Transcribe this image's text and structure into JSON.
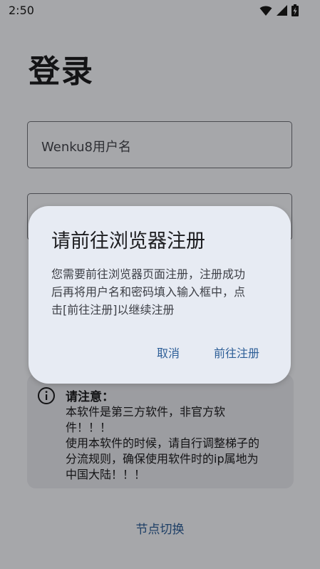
{
  "status_bar": {
    "time": "2:50",
    "icons": [
      "wifi-icon",
      "signal-icon",
      "battery-charging-icon"
    ]
  },
  "page": {
    "title": "登录",
    "username_placeholder": "Wenku8用户名",
    "password_placeholder": ""
  },
  "notice": {
    "icon": "info-icon",
    "title": "请注意：",
    "lines": [
      "本软件是第三方软件，非官方软",
      "件！！！",
      "使用本软件的时候，请自行调整梯子的",
      "分流规则，确保使用软件时的ip属地为",
      "中国大陆！！！"
    ]
  },
  "node_switch_label": "节点切换",
  "dialog": {
    "title": "请前往浏览器注册",
    "body_lines": [
      "您需要前往浏览器页面注册，注册成功",
      "后再将用户名和密码填入输入框中，点",
      "击[前往注册]以继续注册"
    ],
    "cancel_label": "取消",
    "confirm_label": "前往注册"
  },
  "colors": {
    "accent": "#2d5e97",
    "scrim": "rgba(0,0,0,0.32)",
    "dialog_bg": "#e7ebf3"
  }
}
